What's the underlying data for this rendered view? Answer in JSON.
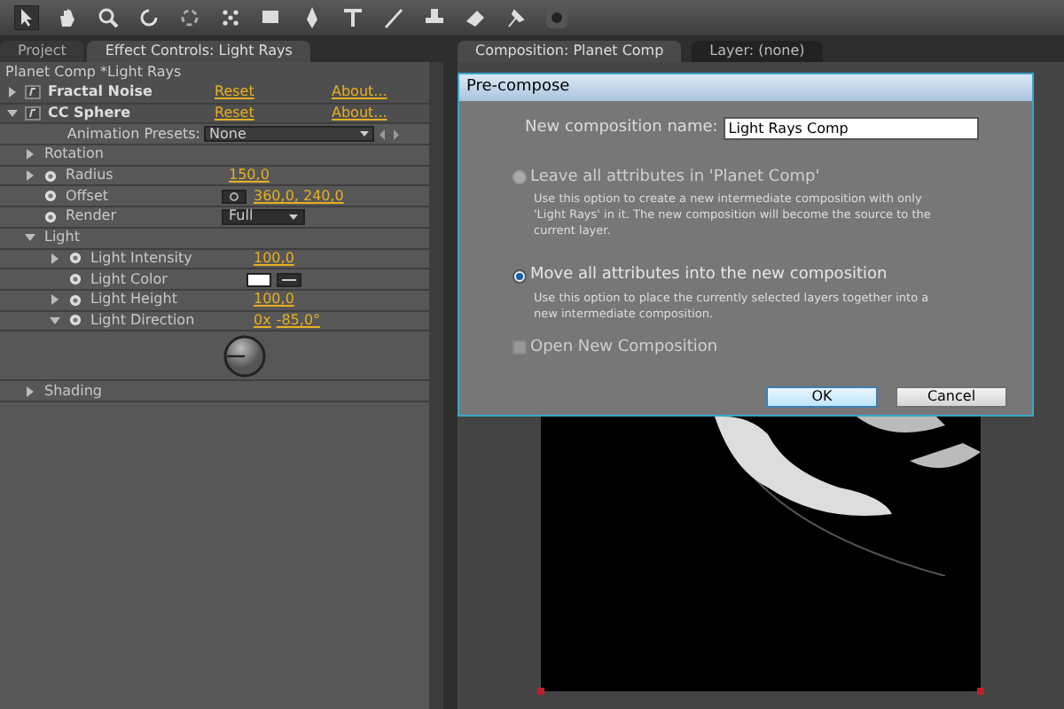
{
  "left_panel": {
    "tabs": [
      {
        "label": "Project",
        "selected": false
      },
      {
        "label": "Effect Controls: Light Rays",
        "selected": true
      }
    ],
    "breadcrumb": "Planet Comp *Light Rays",
    "effects": [
      {
        "name": "Fractal Noise",
        "reset": "Reset",
        "about": "About...",
        "expanded": false
      },
      {
        "name": "CC Sphere",
        "reset": "Reset",
        "about": "About...",
        "expanded": true
      }
    ],
    "presets": {
      "label": "Animation Presets:",
      "value": "None"
    },
    "properties": [
      {
        "kind": "group",
        "label": "Rotation",
        "expanded": false
      },
      {
        "kind": "value",
        "label": "Radius",
        "value": "150,0",
        "expanded": false
      },
      {
        "kind": "point",
        "label": "Offset",
        "value": "360,0, 240,0"
      },
      {
        "kind": "dropdown",
        "label": "Render",
        "value": "Full"
      },
      {
        "kind": "group",
        "label": "Light",
        "expanded": true,
        "children": [
          {
            "kind": "value",
            "label": "Light Intensity",
            "value": "100,0",
            "expanded": false
          },
          {
            "kind": "color",
            "label": "Light Color",
            "color": "#ffffff"
          },
          {
            "kind": "value",
            "label": "Light Height",
            "value": "100,0",
            "expanded": false
          },
          {
            "kind": "angle",
            "label": "Light Direction",
            "revolutions": "0x",
            "value": "-85,0°",
            "expanded": true
          }
        ]
      },
      {
        "kind": "group",
        "label": "Shading",
        "expanded": false
      }
    ]
  },
  "right_panel": {
    "tabs": [
      {
        "label": "Composition: Planet Comp",
        "selected": true
      },
      {
        "label": "Layer: (none)",
        "selected": false
      }
    ]
  },
  "dialog": {
    "title": "Pre-compose",
    "name_label": "New composition name:",
    "name_value": "Light Rays Comp",
    "options": [
      {
        "label": "Leave all attributes in 'Planet Comp'",
        "description": "Use this option to create a new intermediate composition with only 'Light Rays' in it. The new composition will become the source to the current layer.",
        "selected": false,
        "disabled": true
      },
      {
        "label": "Move all attributes into the new composition",
        "description": "Use this option to place the currently selected layers together into a new intermediate composition.",
        "selected": true,
        "disabled": false
      }
    ],
    "checkbox": {
      "label": "Open New Composition",
      "checked": false,
      "disabled": true
    },
    "buttons": [
      {
        "label": "OK",
        "default": true
      },
      {
        "label": "Cancel",
        "default": false
      }
    ]
  }
}
